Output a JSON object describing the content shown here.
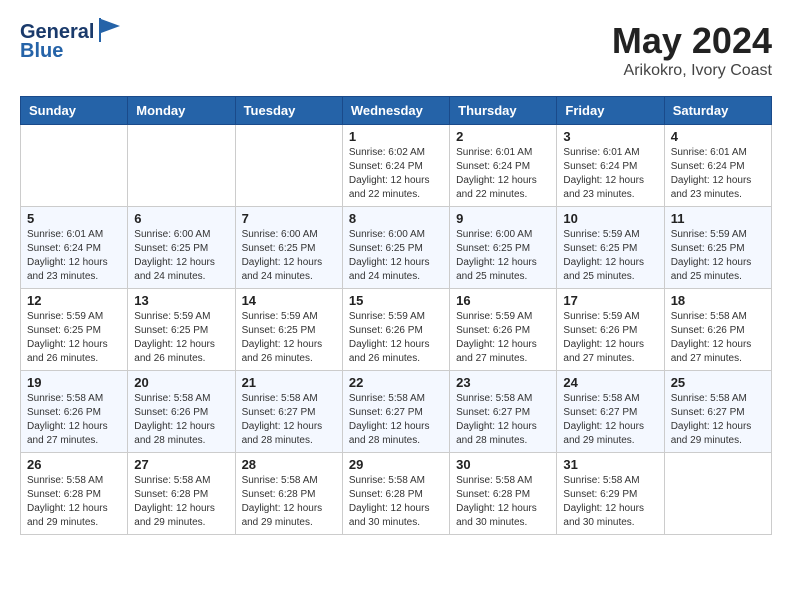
{
  "header": {
    "logo_line1": "General",
    "logo_line2": "Blue",
    "month": "May 2024",
    "location": "Arikokro, Ivory Coast"
  },
  "weekdays": [
    "Sunday",
    "Monday",
    "Tuesday",
    "Wednesday",
    "Thursday",
    "Friday",
    "Saturday"
  ],
  "weeks": [
    [
      {
        "day": "",
        "info": ""
      },
      {
        "day": "",
        "info": ""
      },
      {
        "day": "",
        "info": ""
      },
      {
        "day": "1",
        "info": "Sunrise: 6:02 AM\nSunset: 6:24 PM\nDaylight: 12 hours\nand 22 minutes."
      },
      {
        "day": "2",
        "info": "Sunrise: 6:01 AM\nSunset: 6:24 PM\nDaylight: 12 hours\nand 22 minutes."
      },
      {
        "day": "3",
        "info": "Sunrise: 6:01 AM\nSunset: 6:24 PM\nDaylight: 12 hours\nand 23 minutes."
      },
      {
        "day": "4",
        "info": "Sunrise: 6:01 AM\nSunset: 6:24 PM\nDaylight: 12 hours\nand 23 minutes."
      }
    ],
    [
      {
        "day": "5",
        "info": "Sunrise: 6:01 AM\nSunset: 6:24 PM\nDaylight: 12 hours\nand 23 minutes."
      },
      {
        "day": "6",
        "info": "Sunrise: 6:00 AM\nSunset: 6:25 PM\nDaylight: 12 hours\nand 24 minutes."
      },
      {
        "day": "7",
        "info": "Sunrise: 6:00 AM\nSunset: 6:25 PM\nDaylight: 12 hours\nand 24 minutes."
      },
      {
        "day": "8",
        "info": "Sunrise: 6:00 AM\nSunset: 6:25 PM\nDaylight: 12 hours\nand 24 minutes."
      },
      {
        "day": "9",
        "info": "Sunrise: 6:00 AM\nSunset: 6:25 PM\nDaylight: 12 hours\nand 25 minutes."
      },
      {
        "day": "10",
        "info": "Sunrise: 5:59 AM\nSunset: 6:25 PM\nDaylight: 12 hours\nand 25 minutes."
      },
      {
        "day": "11",
        "info": "Sunrise: 5:59 AM\nSunset: 6:25 PM\nDaylight: 12 hours\nand 25 minutes."
      }
    ],
    [
      {
        "day": "12",
        "info": "Sunrise: 5:59 AM\nSunset: 6:25 PM\nDaylight: 12 hours\nand 26 minutes."
      },
      {
        "day": "13",
        "info": "Sunrise: 5:59 AM\nSunset: 6:25 PM\nDaylight: 12 hours\nand 26 minutes."
      },
      {
        "day": "14",
        "info": "Sunrise: 5:59 AM\nSunset: 6:25 PM\nDaylight: 12 hours\nand 26 minutes."
      },
      {
        "day": "15",
        "info": "Sunrise: 5:59 AM\nSunset: 6:26 PM\nDaylight: 12 hours\nand 26 minutes."
      },
      {
        "day": "16",
        "info": "Sunrise: 5:59 AM\nSunset: 6:26 PM\nDaylight: 12 hours\nand 27 minutes."
      },
      {
        "day": "17",
        "info": "Sunrise: 5:59 AM\nSunset: 6:26 PM\nDaylight: 12 hours\nand 27 minutes."
      },
      {
        "day": "18",
        "info": "Sunrise: 5:58 AM\nSunset: 6:26 PM\nDaylight: 12 hours\nand 27 minutes."
      }
    ],
    [
      {
        "day": "19",
        "info": "Sunrise: 5:58 AM\nSunset: 6:26 PM\nDaylight: 12 hours\nand 27 minutes."
      },
      {
        "day": "20",
        "info": "Sunrise: 5:58 AM\nSunset: 6:26 PM\nDaylight: 12 hours\nand 28 minutes."
      },
      {
        "day": "21",
        "info": "Sunrise: 5:58 AM\nSunset: 6:27 PM\nDaylight: 12 hours\nand 28 minutes."
      },
      {
        "day": "22",
        "info": "Sunrise: 5:58 AM\nSunset: 6:27 PM\nDaylight: 12 hours\nand 28 minutes."
      },
      {
        "day": "23",
        "info": "Sunrise: 5:58 AM\nSunset: 6:27 PM\nDaylight: 12 hours\nand 28 minutes."
      },
      {
        "day": "24",
        "info": "Sunrise: 5:58 AM\nSunset: 6:27 PM\nDaylight: 12 hours\nand 29 minutes."
      },
      {
        "day": "25",
        "info": "Sunrise: 5:58 AM\nSunset: 6:27 PM\nDaylight: 12 hours\nand 29 minutes."
      }
    ],
    [
      {
        "day": "26",
        "info": "Sunrise: 5:58 AM\nSunset: 6:28 PM\nDaylight: 12 hours\nand 29 minutes."
      },
      {
        "day": "27",
        "info": "Sunrise: 5:58 AM\nSunset: 6:28 PM\nDaylight: 12 hours\nand 29 minutes."
      },
      {
        "day": "28",
        "info": "Sunrise: 5:58 AM\nSunset: 6:28 PM\nDaylight: 12 hours\nand 29 minutes."
      },
      {
        "day": "29",
        "info": "Sunrise: 5:58 AM\nSunset: 6:28 PM\nDaylight: 12 hours\nand 30 minutes."
      },
      {
        "day": "30",
        "info": "Sunrise: 5:58 AM\nSunset: 6:28 PM\nDaylight: 12 hours\nand 30 minutes."
      },
      {
        "day": "31",
        "info": "Sunrise: 5:58 AM\nSunset: 6:29 PM\nDaylight: 12 hours\nand 30 minutes."
      },
      {
        "day": "",
        "info": ""
      }
    ]
  ]
}
